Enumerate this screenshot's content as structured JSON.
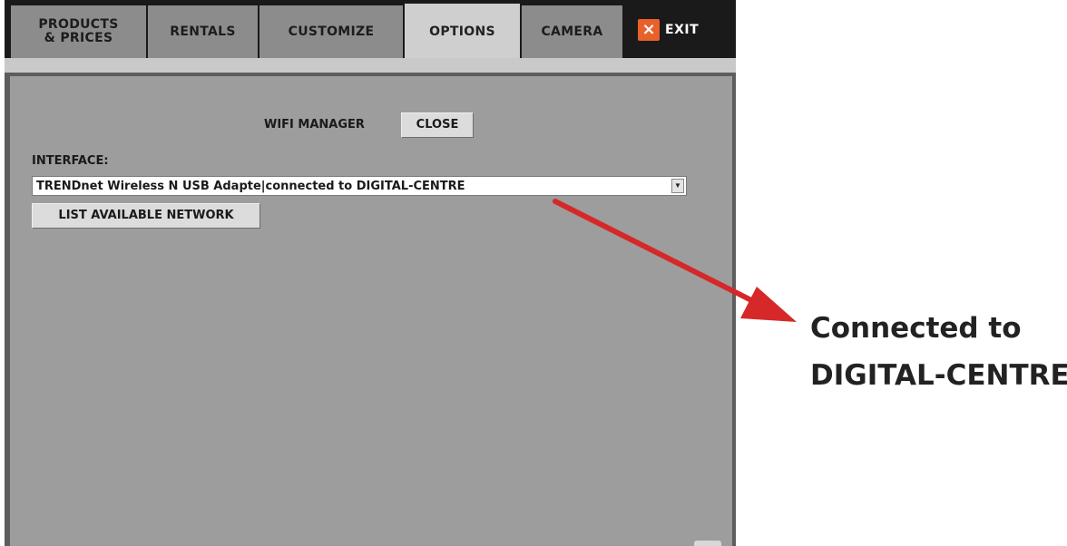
{
  "tabs": [
    {
      "label": "PRODUCTS\n& PRICES",
      "active": false
    },
    {
      "label": "RENTALS",
      "active": false
    },
    {
      "label": "CUSTOMIZE",
      "active": false
    },
    {
      "label": "OPTIONS",
      "active": true
    },
    {
      "label": "CAMERA",
      "active": false
    }
  ],
  "exit": {
    "icon": "close-icon",
    "glyph": "×",
    "label": "EXIT",
    "color": "#e8612a"
  },
  "wifi_manager": {
    "title": "WIFI MANAGER",
    "close_label": "CLOSE",
    "interface_label": "INTERFACE:",
    "interface_value": "TRENDnet Wireless N USB Adapte|connected to DIGITAL-CENTRE",
    "list_networks_label": "LIST AVAILABLE NETWORK"
  },
  "annotation": {
    "line1": "Connected to",
    "line2": "DIGITAL-CENTRE",
    "arrow_color": "#d62828"
  }
}
